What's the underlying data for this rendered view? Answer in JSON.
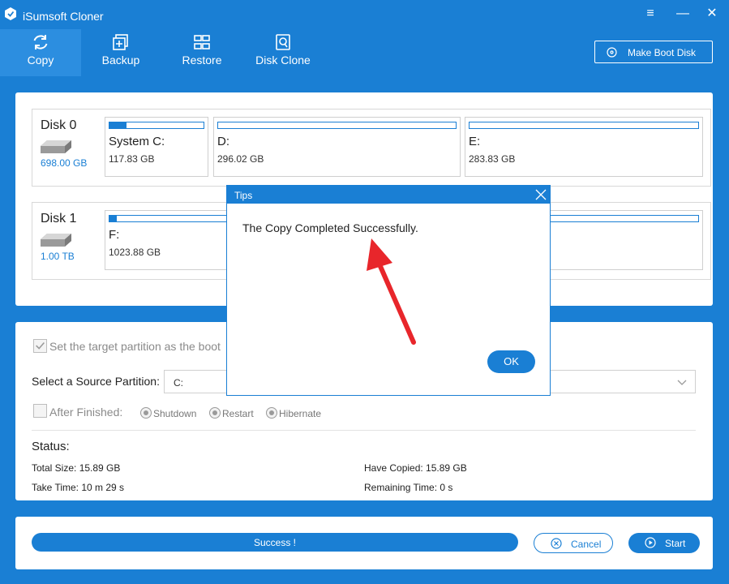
{
  "app": {
    "title": "iSumsoft Cloner"
  },
  "nav": {
    "tabs": [
      {
        "label": "Copy",
        "icon": "refresh-icon"
      },
      {
        "label": "Backup",
        "icon": "backup-icon"
      },
      {
        "label": "Restore",
        "icon": "restore-icon"
      },
      {
        "label": "Disk Clone",
        "icon": "disk-clone-icon"
      }
    ]
  },
  "toolbar": {
    "make_boot_disk": "Make Boot Disk"
  },
  "disks": [
    {
      "name": "Disk 0",
      "size": "698.00 GB",
      "partitions": [
        {
          "name": "System C:",
          "size": "117.83 GB",
          "fill": 0.18
        },
        {
          "name": "D:",
          "size": "296.02 GB",
          "fill": 0
        },
        {
          "name": "E:",
          "size": "283.83 GB",
          "fill": 0
        }
      ]
    },
    {
      "name": "Disk 1",
      "size": "1.00 TB",
      "partitions": [
        {
          "name": "F:",
          "size": "1023.88 GB",
          "fill": 0.013
        }
      ]
    }
  ],
  "options": {
    "boot_checkbox_label": "Set the target partition as the boot",
    "source_label": "Select a Source Partition:",
    "source_value": "C:",
    "after_finished_label": "After Finished:",
    "radios": [
      "Shutdown",
      "Restart",
      "Hibernate"
    ]
  },
  "status": {
    "heading": "Status:",
    "total_size": "Total Size: 15.89 GB",
    "have_copied": "Have Copied: 15.89 GB",
    "take_time": "Take Time: 10 m 29 s",
    "remaining_time": "Remaining Time: 0 s"
  },
  "bottom": {
    "progress_text": "Success !",
    "progress": 1.0,
    "cancel": "Cancel",
    "start": "Start"
  },
  "dialog": {
    "title": "Tips",
    "message": "The Copy Completed Successfully.",
    "ok": "OK"
  },
  "colors": {
    "accent": "#1a7fd4",
    "annotation_arrow": "#e8262b"
  }
}
